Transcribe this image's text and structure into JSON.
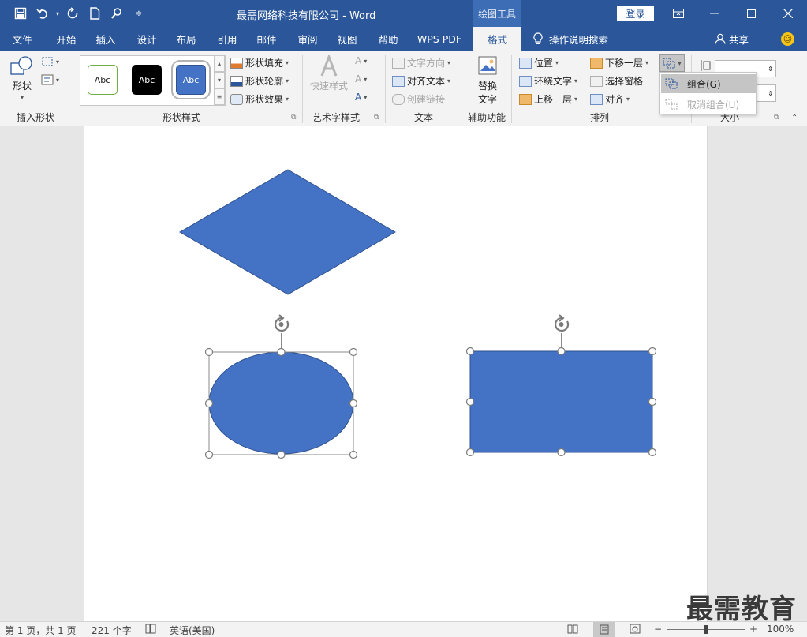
{
  "titlebar": {
    "title": "最需网络科技有限公司  -  Word",
    "context_tab_group": "绘图工具",
    "login_label": "登录",
    "qa_icons": [
      "save-icon",
      "undo-icon",
      "redo-icon",
      "new-doc-icon",
      "touch-mode-icon",
      "customize-icon"
    ]
  },
  "tabs": [
    {
      "label": "文件"
    },
    {
      "label": "开始"
    },
    {
      "label": "插入"
    },
    {
      "label": "设计"
    },
    {
      "label": "布局"
    },
    {
      "label": "引用"
    },
    {
      "label": "邮件"
    },
    {
      "label": "审阅"
    },
    {
      "label": "视图"
    },
    {
      "label": "帮助"
    },
    {
      "label": "WPS PDF"
    },
    {
      "label": "格式",
      "active": true
    }
  ],
  "tell_me": "操作说明搜索",
  "share": "共享",
  "ribbon": {
    "insert_shapes": {
      "shapes_label": "形状",
      "group": "插入形状"
    },
    "shape_styles": {
      "presets": [
        "Abc",
        "Abc",
        "Abc"
      ],
      "fill": "形状填充",
      "outline": "形状轮廓",
      "effects": "形状效果",
      "group": "形状样式"
    },
    "wordart": {
      "quick_styles": "快速样式",
      "group": "艺术字样式"
    },
    "text": {
      "direction": "文字方向",
      "align": "对齐文本",
      "link": "创建链接",
      "group": "文本"
    },
    "accessibility": {
      "alt_text_1": "替换",
      "alt_text_2": "文字",
      "group": "辅助功能"
    },
    "arrange": {
      "position": "位置",
      "wrap": "环绕文字",
      "bring_forward": "上移一层",
      "send_backward": "下移一层",
      "selection_pane": "选择窗格",
      "align": "对齐",
      "group": "排列"
    },
    "size": {
      "group": "大小"
    }
  },
  "group_menu": {
    "group": "组合(G)",
    "ungroup": "取消组合(U)"
  },
  "statusbar": {
    "page": "第 1 页，共 1 页",
    "words": "221 个字",
    "language": "英语(美国)",
    "zoom": "100%",
    "zoom_minus": "−",
    "zoom_plus": "+"
  },
  "watermark": "最需教育",
  "colors": {
    "accent": "#2b579a",
    "shape_fill": "#4472c4",
    "shape_outline": "#2f528f"
  }
}
